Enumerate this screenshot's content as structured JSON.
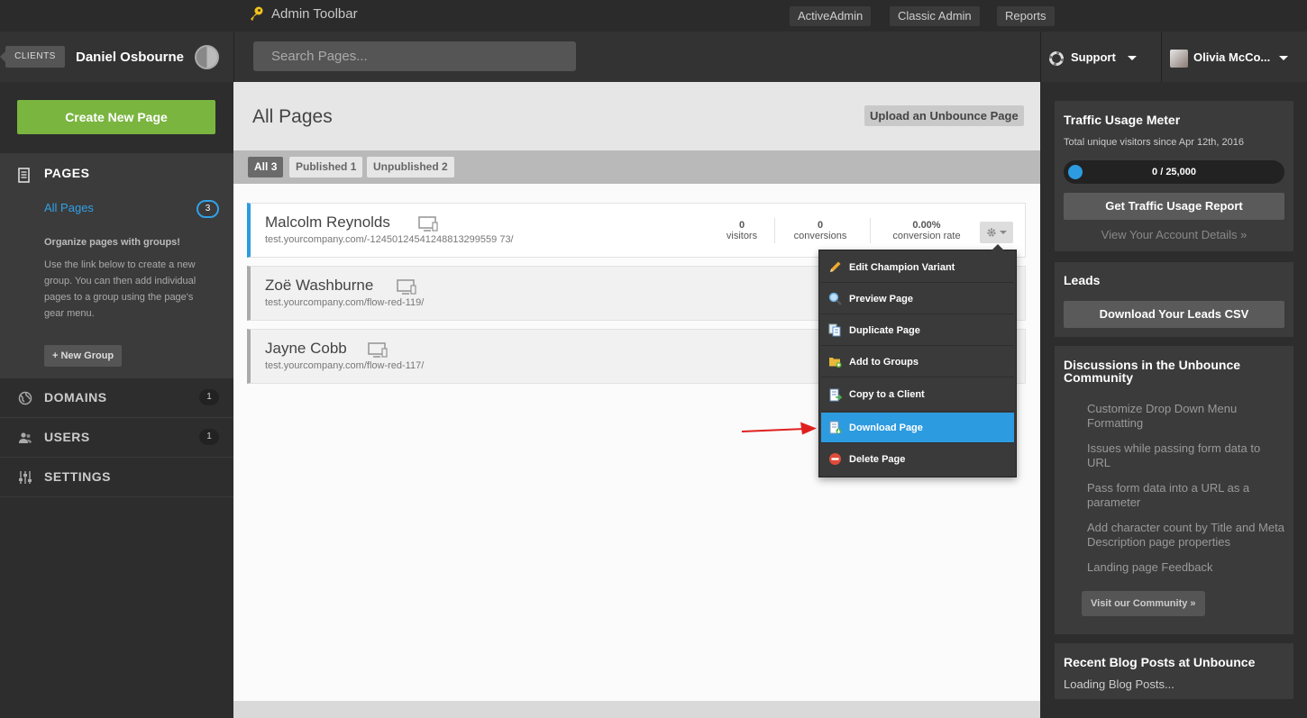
{
  "admin_toolbar": {
    "title": "Admin Toolbar",
    "links": [
      "ActiveAdmin",
      "Classic Admin",
      "Reports"
    ]
  },
  "header": {
    "clients_label": "CLIENTS",
    "client_name": "Daniel Osbourne",
    "search_placeholder": "Search Pages...",
    "support_label": "Support",
    "user_name": "Olivia McCo..."
  },
  "sidebar": {
    "create_button": "Create New Page",
    "pages_label": "PAGES",
    "all_pages_label": "All Pages",
    "all_pages_count": "3",
    "groups_heading": "Organize pages with groups!",
    "groups_text": "Use the link below to create a new group. You can then add individual pages to a group using the page's gear menu.",
    "new_group_button": "+ New Group",
    "nav": [
      {
        "label": "DOMAINS",
        "count": "1"
      },
      {
        "label": "USERS",
        "count": "1"
      },
      {
        "label": "SETTINGS",
        "count": ""
      }
    ]
  },
  "main": {
    "title": "All Pages",
    "upload_button": "Upload an Unbounce Page",
    "filters": [
      {
        "label": "All",
        "count": "3"
      },
      {
        "label": "Published",
        "count": "1"
      },
      {
        "label": "Unpublished",
        "count": "2"
      }
    ],
    "pages": [
      {
        "name": "Malcolm Reynolds",
        "url": "test.yourcompany.com/-12450124541248813299559 73/"
      },
      {
        "name": "Zoë Washburne",
        "url": "test.yourcompany.com/flow-red-119/"
      },
      {
        "name": "Jayne Cobb",
        "url": "test.yourcompany.com/flow-red-117/"
      }
    ],
    "stats": {
      "visitors": "0",
      "visitors_label": "visitors",
      "conversions": "0",
      "conversions_label": "conversions",
      "rate": "0.00%",
      "rate_label": "conversion rate"
    }
  },
  "gear_menu": {
    "items": [
      {
        "label": "Edit Champion Variant",
        "icon": "pencil-icon"
      },
      {
        "label": "Preview Page",
        "icon": "magnifier-icon"
      },
      {
        "label": "Duplicate Page",
        "icon": "duplicate-icon"
      },
      {
        "label": "Add to Groups",
        "icon": "folder-icon"
      },
      {
        "label": "Copy to a Client",
        "icon": "copy-client-icon"
      },
      {
        "label": "Download Page",
        "icon": "download-icon"
      },
      {
        "label": "Delete Page",
        "icon": "delete-icon"
      }
    ],
    "highlighted": "Download Page"
  },
  "right_panel": {
    "traffic": {
      "title": "Traffic Usage Meter",
      "subtitle": "Total unique visitors since Apr 12th, 2016",
      "meter_text": "0 / 25,000",
      "used": 0,
      "limit": 25000,
      "report_button": "Get Traffic Usage Report",
      "account_link": "View Your Account Details »"
    },
    "leads": {
      "title": "Leads",
      "button": "Download Your Leads CSV"
    },
    "discussions": {
      "title": "Discussions in the Unbounce Community",
      "links": [
        "Customize Drop Down Menu Formatting",
        "Issues while passing form data to URL",
        "Pass form data into a URL as a parameter",
        "Add character count by Title and Meta Description page properties",
        "Landing page Feedback"
      ],
      "button": "Visit our Community »"
    },
    "blog": {
      "title": "Recent Blog Posts at Unbounce",
      "loading": "Loading Blog Posts..."
    }
  },
  "colors": {
    "accent_blue": "#2d9be0",
    "create_green": "#7ab540",
    "arrow_red": "#e02020"
  }
}
